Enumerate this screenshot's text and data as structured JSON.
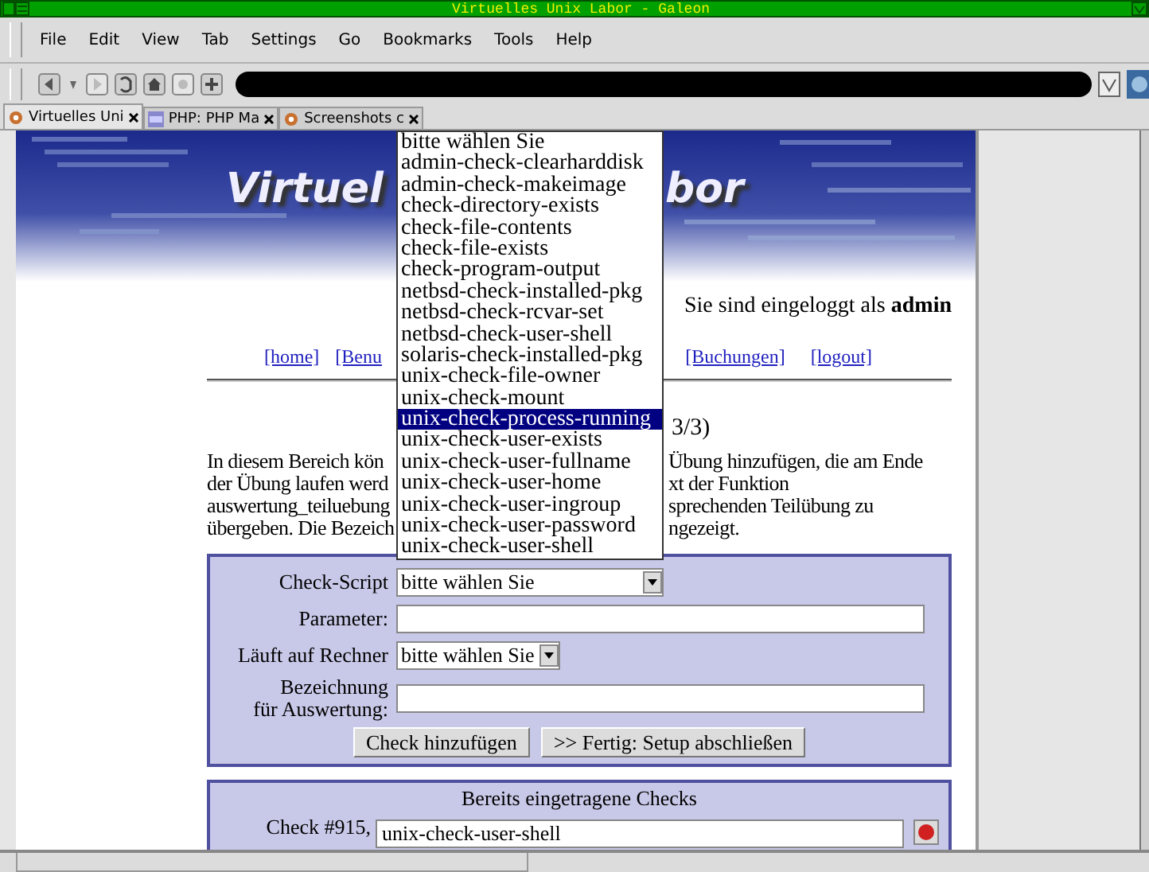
{
  "window": {
    "title": "Virtuelles Unix Labor - Galeon"
  },
  "menu": [
    "File",
    "Edit",
    "View",
    "Tab",
    "Settings",
    "Go",
    "Bookmarks",
    "Tools",
    "Help"
  ],
  "tabs": [
    {
      "label": "Virtuelles Uni",
      "selected": true
    },
    {
      "label": "PHP: PHP Ma",
      "selected": false
    },
    {
      "label": "Screenshots c",
      "selected": false
    }
  ],
  "page": {
    "banner": {
      "kind": "picture",
      "title_left": "Virtuel",
      "title_right": "bor"
    },
    "login": "Sie sind eingeloggt als **admin**",
    "nav": {
      "left": [
        "[home]",
        "[Benu"
      ],
      "right": [
        "[Buchungen]",
        "[logout]"
      ]
    },
    "heading": "3/3)",
    "paragraph": [
      {
        "left": "In diesem Bereich kön",
        "right": "Übung hinzufügen, die am Ende"
      },
      {
        "left": "der Übung laufen werd",
        "right": "xt der Funktion"
      },
      {
        "left": "auswertung_teiluebung",
        "right": "sprechenden Teilübung zu"
      },
      {
        "left": "übergeben. Die Bezeich",
        "right": "ngezeigt."
      }
    ],
    "form": {
      "check_script": {
        "label": "Check-Script",
        "value": "bitte wählen Sie"
      },
      "parameter": {
        "label": "Parameter:"
      },
      "rechner": {
        "label": "Läuft auf Rechner",
        "value": "bitte wählen Sie"
      },
      "bezeichnung": {
        "label": "Bezeichnung\nfür Auswertung:"
      },
      "buttons": [
        "Check hinzufügen",
        ">> Fertig: Setup abschließen"
      ]
    },
    "dropdown": {
      "options": [
        {
          "label": "bitte wählen Sie",
          "selected": false
        },
        {
          "label": "admin-check-clearharddisk",
          "selected": false
        },
        {
          "label": "admin-check-makeimage",
          "selected": false
        },
        {
          "label": "check-directory-exists",
          "selected": false
        },
        {
          "label": "check-file-contents",
          "selected": false
        },
        {
          "label": "check-file-exists",
          "selected": false
        },
        {
          "label": "check-program-output",
          "selected": false
        },
        {
          "label": "netbsd-check-installed-pkg",
          "selected": false
        },
        {
          "label": "netbsd-check-rcvar-set",
          "selected": false
        },
        {
          "label": "netbsd-check-user-shell",
          "selected": false
        },
        {
          "label": "solaris-check-installed-pkg",
          "selected": false
        },
        {
          "label": "unix-check-file-owner",
          "selected": false
        },
        {
          "label": "unix-check-mount",
          "selected": false
        },
        {
          "label": "unix-check-process-running",
          "selected": true
        },
        {
          "label": "unix-check-user-exists",
          "selected": false
        },
        {
          "label": "unix-check-user-fullname",
          "selected": false
        },
        {
          "label": "unix-check-user-home",
          "selected": false
        },
        {
          "label": "unix-check-user-ingroup",
          "selected": false
        },
        {
          "label": "unix-check-user-password",
          "selected": false
        },
        {
          "label": "unix-check-user-shell",
          "selected": false
        }
      ]
    },
    "checks": {
      "title": "Bereits eingetragene Checks",
      "rows": [
        {
          "label": "Check #915,",
          "value": "unix-check-user-shell"
        }
      ]
    }
  }
}
